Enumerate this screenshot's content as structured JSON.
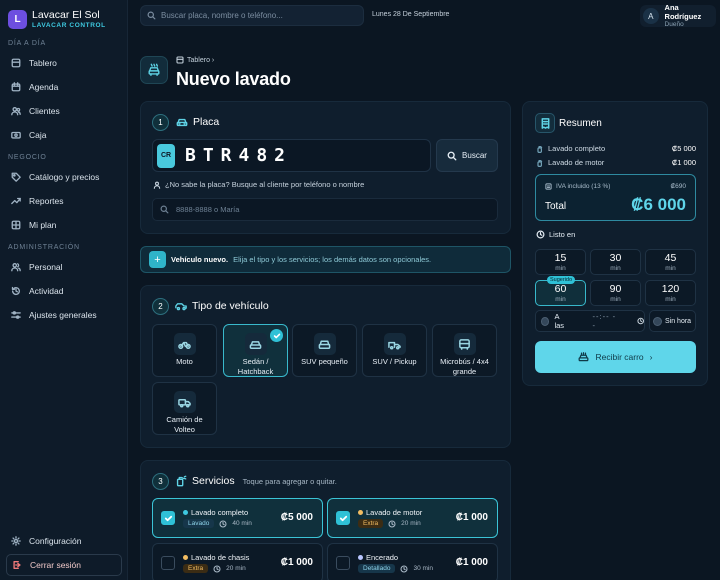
{
  "brand": {
    "logo_letter": "L",
    "name": "Lavacar El Sol",
    "subtitle": "LAVACAR CONTROL"
  },
  "sidebar": {
    "sections": [
      "DÍA A DÍA",
      "NEGOCIO",
      "ADMINISTRACIÓN"
    ],
    "items": [
      {
        "label": "Tablero",
        "icon": "dashboard-icon"
      },
      {
        "label": "Agenda",
        "icon": "calendar-icon"
      },
      {
        "label": "Clientes",
        "icon": "users-icon"
      },
      {
        "label": "Caja",
        "icon": "cash-icon"
      },
      {
        "label": "Catálogo y precios",
        "icon": "tag-icon"
      },
      {
        "label": "Reportes",
        "icon": "chart-icon"
      },
      {
        "label": "Mi plan",
        "icon": "grid-icon"
      },
      {
        "label": "Personal",
        "icon": "people-icon"
      },
      {
        "label": "Actividad",
        "icon": "history-icon"
      },
      {
        "label": "Ajustes generales",
        "icon": "sliders-icon"
      }
    ],
    "config": "Configuración",
    "logout": "Cerrar sesión"
  },
  "header": {
    "search_placeholder": "Buscar placa, nombre o teléfono...",
    "date": "Lunes 28 De Septiembre",
    "user": {
      "initial": "A",
      "name": "Ana Rodríguez",
      "role": "Dueño"
    }
  },
  "page": {
    "breadcrumb": "Tablero ›",
    "title": "Nuevo lavado"
  },
  "plate_section": {
    "step": "1",
    "title": "Placa",
    "country": "CR",
    "value": "BTR482",
    "search_button": "Buscar",
    "hint": "¿No sabe la placa? Busque al cliente por teléfono o nombre",
    "phone_placeholder": "8888-8888 o María"
  },
  "banner": {
    "strong": "Vehículo nuevo.",
    "text": "Elija el tipo y los servicios; los demás datos son opcionales."
  },
  "vehicle_section": {
    "step": "2",
    "title": "Tipo de vehículo",
    "types": [
      {
        "label": "Moto",
        "icon": "motorcycle-icon",
        "selected": false
      },
      {
        "label": "Sedán / Hatchback",
        "icon": "car-icon",
        "selected": true
      },
      {
        "label": "SUV pequeño",
        "icon": "suv-icon",
        "selected": false
      },
      {
        "label": "SUV / Pickup",
        "icon": "pickup-icon",
        "selected": false
      },
      {
        "label": "Microbús / 4x4 grande",
        "icon": "bus-icon",
        "selected": false
      },
      {
        "label": "Camión de Volteo",
        "icon": "truck-icon",
        "selected": false
      }
    ]
  },
  "services_section": {
    "step": "3",
    "title": "Servicios",
    "hint": "Toque para agregar o quitar.",
    "services": [
      {
        "name": "Lavado completo",
        "tag": "Lavado",
        "duration": "40 min",
        "price": "₡5 000",
        "selected": true,
        "dot": "#3ec9e0"
      },
      {
        "name": "Lavado de motor",
        "tag": "Extra",
        "duration": "20 min",
        "price": "₡1 000",
        "selected": true,
        "dot": "#f3bd62"
      },
      {
        "name": "Lavado de chasis",
        "tag": "Extra",
        "duration": "20 min",
        "price": "₡1 000",
        "selected": false,
        "dot": "#f3bd62"
      },
      {
        "name": "Encerado",
        "tag": "Detallado",
        "duration": "30 min",
        "price": "₡1 000",
        "selected": false,
        "dot": "#b9c6ff"
      }
    ]
  },
  "summary": {
    "title": "Resumen",
    "lines": [
      {
        "label": "Lavado completo",
        "value": "₡5 000"
      },
      {
        "label": "Lavado de motor",
        "value": "₡1 000"
      }
    ],
    "iva_label": "IVA incluido (13 %)",
    "iva_value": "₡690",
    "total_label": "Total",
    "total_value": "₡6 000",
    "ready_label": "Listo en",
    "times": [
      {
        "n": "15",
        "u": "min",
        "selected": false
      },
      {
        "n": "30",
        "u": "min",
        "selected": false
      },
      {
        "n": "45",
        "u": "min",
        "selected": false
      },
      {
        "n": "60",
        "u": "min",
        "selected": true,
        "badge": "Sugerido"
      },
      {
        "n": "90",
        "u": "min",
        "selected": false
      },
      {
        "n": "120",
        "u": "min",
        "selected": false
      }
    ],
    "at_label": "A las",
    "at_value": "--:-- --",
    "no_time_label": "Sin hora",
    "receive_button": "Recibir carro"
  },
  "colors": {
    "accent": "#5fd6ea",
    "background": "#0b1622",
    "brand": "#6d4fe0"
  }
}
